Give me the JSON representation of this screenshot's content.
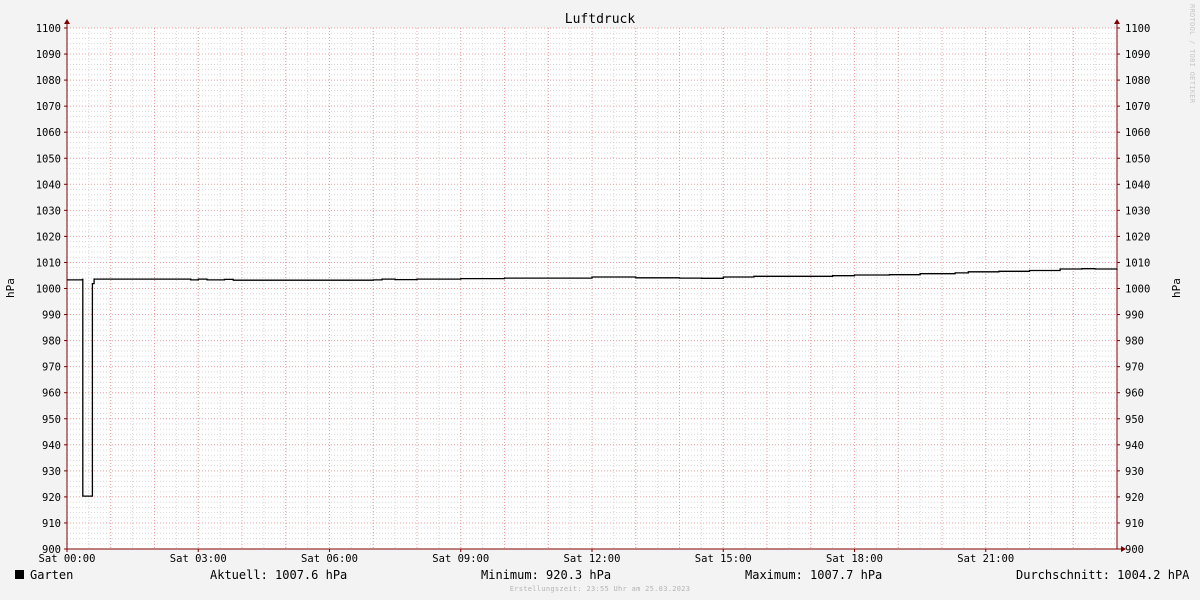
{
  "chart_data": {
    "type": "line",
    "title": "Luftdruck",
    "ylabel_left": "hPa",
    "ylabel_right": "hPa",
    "ylim": [
      900,
      1100
    ],
    "y_ticks": [
      900,
      910,
      920,
      930,
      940,
      950,
      960,
      970,
      980,
      990,
      1000,
      1010,
      1020,
      1030,
      1040,
      1050,
      1060,
      1070,
      1080,
      1090,
      1100
    ],
    "x_range_hours": [
      0,
      24
    ],
    "x_ticks": [
      {
        "hour": 0,
        "label": "Sat 00:00"
      },
      {
        "hour": 3,
        "label": "Sat 03:00"
      },
      {
        "hour": 6,
        "label": "Sat 06:00"
      },
      {
        "hour": 9,
        "label": "Sat 09:00"
      },
      {
        "hour": 12,
        "label": "Sat 12:00"
      },
      {
        "hour": 15,
        "label": "Sat 15:00"
      },
      {
        "hour": 18,
        "label": "Sat 18:00"
      },
      {
        "hour": 21,
        "label": "Sat 21:00"
      }
    ],
    "grid": true,
    "series": [
      {
        "name": "Garten",
        "color": "#000000",
        "points": [
          [
            0.0,
            1003.3
          ],
          [
            0.35,
            1003.5
          ],
          [
            0.36,
            920.3
          ],
          [
            0.4,
            920.3
          ],
          [
            0.58,
            1001.9
          ],
          [
            0.62,
            1003.6
          ],
          [
            1.0,
            1003.6
          ],
          [
            2.0,
            1003.6
          ],
          [
            2.83,
            1003.3
          ],
          [
            3.0,
            1003.6
          ],
          [
            3.2,
            1003.3
          ],
          [
            3.6,
            1003.5
          ],
          [
            3.8,
            1003.2
          ],
          [
            5.0,
            1003.2
          ],
          [
            7.0,
            1003.3
          ],
          [
            7.2,
            1003.6
          ],
          [
            7.5,
            1003.4
          ],
          [
            8.0,
            1003.6
          ],
          [
            9.0,
            1003.8
          ],
          [
            10.0,
            1004.0
          ],
          [
            11.0,
            1004.0
          ],
          [
            12.0,
            1004.4
          ],
          [
            13.0,
            1004.1
          ],
          [
            14.0,
            1004.0
          ],
          [
            14.5,
            1003.9
          ],
          [
            15.0,
            1004.4
          ],
          [
            15.7,
            1004.7
          ],
          [
            16.5,
            1004.7
          ],
          [
            17.5,
            1004.9
          ],
          [
            18.0,
            1005.2
          ],
          [
            18.8,
            1005.3
          ],
          [
            19.5,
            1005.7
          ],
          [
            20.3,
            1006.0
          ],
          [
            20.6,
            1006.4
          ],
          [
            21.3,
            1006.6
          ],
          [
            22.0,
            1006.9
          ],
          [
            22.7,
            1007.5
          ],
          [
            23.2,
            1007.6
          ],
          [
            23.5,
            1007.5
          ],
          [
            24.0,
            1007.6
          ]
        ]
      }
    ]
  },
  "legend": {
    "series_name": "Garten",
    "aktuell": "Aktuell: 1007.6 hPa",
    "minimum": "Minimum: 920.3 hPa",
    "maximum": "Maximum: 1007.7 hPa",
    "durchschnitt": "Durchschnitt: 1004.2 hPA"
  },
  "footer": "Erstellungszeit: 23:55 Uhr am 25.03.2023",
  "watermark": "RRDTOOL / TOBI OETIKER",
  "colors": {
    "background": "#f3f3f3",
    "plot_background": "#ffffff",
    "major_grid": "#e8a0a0",
    "minor_grid": "#d8d8d8",
    "axis": "#800000",
    "line": "#000000"
  }
}
